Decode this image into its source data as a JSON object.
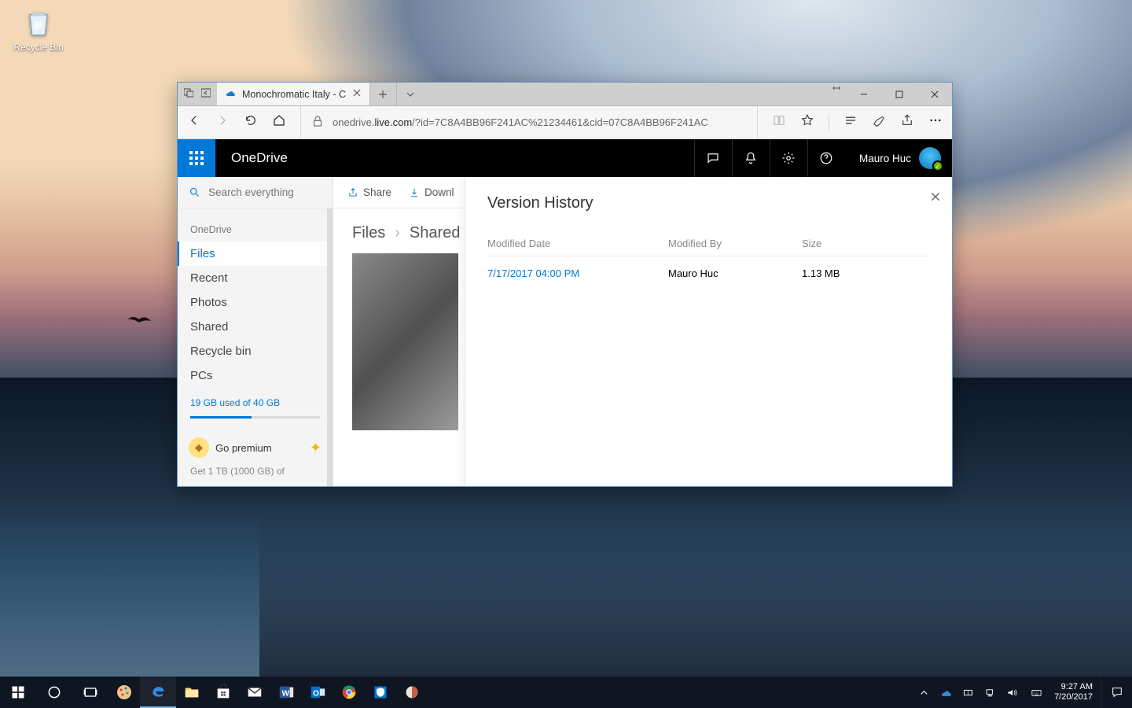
{
  "desktop": {
    "recycle_bin": "Recycle Bin"
  },
  "browser": {
    "tab_title": "Monochromatic Italy - C",
    "url_display_domain": "onedrive.",
    "url_display_host": "live.com",
    "url_display_path": "/?id=7C8A4BB96F241AC%21234461&cid=07C8A4BB96F241AC"
  },
  "onedrive": {
    "app_name": "OneDrive",
    "user_name": "Mauro Huc",
    "search_placeholder": "Search everything",
    "sidebar": {
      "group_title": "OneDrive",
      "items": [
        "Files",
        "Recent",
        "Photos",
        "Shared",
        "Recycle bin",
        "PCs"
      ],
      "storage_text": "19 GB used of 40 GB",
      "storage_pct": 47,
      "premium_label": "Go premium",
      "premium_sub": "Get 1 TB (1000 GB) of"
    },
    "commands": {
      "share": "Share",
      "download": "Downl"
    },
    "breadcrumb": {
      "root": "Files",
      "current": "Shared"
    },
    "panel": {
      "title": "Version History",
      "cols": {
        "date": "Modified Date",
        "by": "Modified By",
        "size": "Size"
      },
      "rows": [
        {
          "date": "7/17/2017 04:00 PM",
          "by": "Mauro Huc",
          "size": "1.13 MB"
        }
      ]
    }
  },
  "taskbar": {
    "clock_time": "9:27 AM",
    "clock_date": "7/20/2017"
  }
}
